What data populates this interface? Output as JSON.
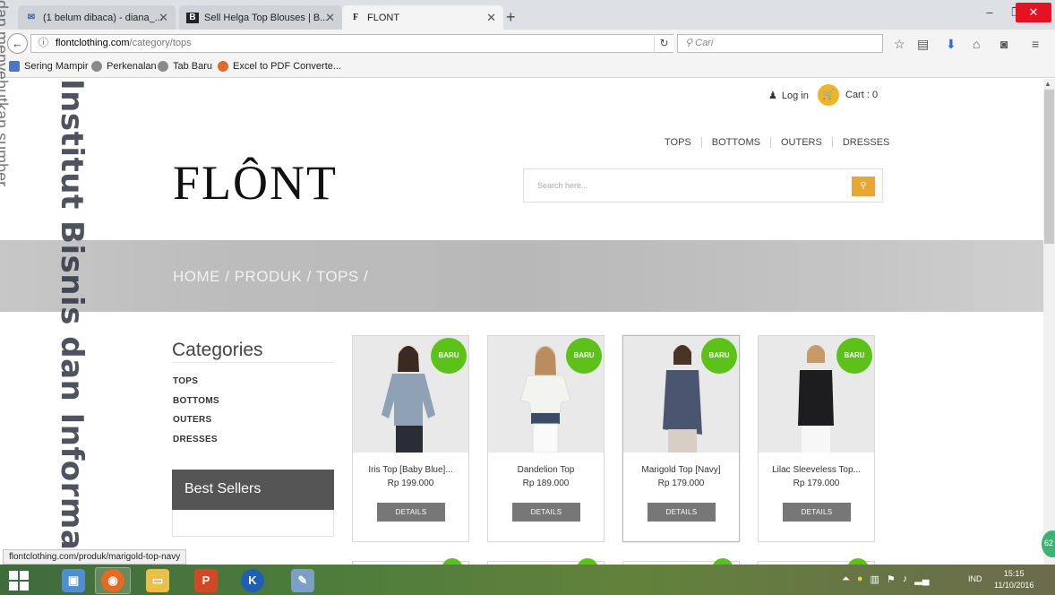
{
  "browser": {
    "tabs": [
      {
        "title": "(1 belum dibaca) - diana_...",
        "icon": "mail-icon",
        "active": false
      },
      {
        "title": "Sell Helga Top Blouses | B...",
        "icon": "b-icon",
        "active": false
      },
      {
        "title": "FLONT",
        "icon": "flont-icon",
        "active": true
      }
    ],
    "url_host": "flontclothing.com",
    "url_path": "/category/tops",
    "search_placeholder": "Cari",
    "bookmarks": [
      "Sering Mampir",
      "Perkenalan",
      "Tab Baru",
      "Excel to PDF Converte..."
    ]
  },
  "site": {
    "login_label": "Log in",
    "cart_label": "Cart : 0",
    "logo": "FLÔNT",
    "nav": [
      "TOPS",
      "BOTTOMS",
      "OUTERS",
      "DRESSES"
    ],
    "search_placeholder": "Search here...",
    "breadcrumb": "HOME / PRODUK / TOPS /",
    "categories_title": "Categories",
    "categories": [
      "TOPS",
      "BOTTOMS",
      "OUTERS",
      "DRESSES"
    ],
    "best_sellers_title": "Best Sellers",
    "products": [
      {
        "name": "Iris Top [Baby Blue]...",
        "price": "Rp 199.000",
        "badge": "BARU",
        "details": "DETAILS",
        "shirt": "#8fa1b5",
        "pants": "#2a2d34"
      },
      {
        "name": "Dandelion Top",
        "price": "Rp 189.000",
        "badge": "BARU",
        "details": "DETAILS",
        "shirt": "#f3f3f0",
        "pants": "#3d4a6a"
      },
      {
        "name": "Marigold Top [Navy]",
        "price": "Rp 179.000",
        "badge": "BARU",
        "details": "DETAILS",
        "shirt": "#4a5670",
        "pants": "#d7cfc6"
      },
      {
        "name": "Lilac Sleeveless Top...",
        "price": "Rp 179.000",
        "badge": "BARU",
        "details": "DETAILS",
        "shirt": "#1d1d1f",
        "pants": "#f7f7f7"
      }
    ]
  },
  "watermark": {
    "main": "Institut Bisnis dan Informatika",
    "side": "dan menyebutkan sumber."
  },
  "status_url": "flontclothing.com/produk/marigold-top-navy",
  "fab_count": "62",
  "taskbar": {
    "lang": "IND",
    "time": "15:15",
    "date": "11/10/2016"
  },
  "colors": {
    "badge": "#5cc21a",
    "cart": "#f0b429",
    "search_button": "#e8a634",
    "details_button": "#777777"
  }
}
